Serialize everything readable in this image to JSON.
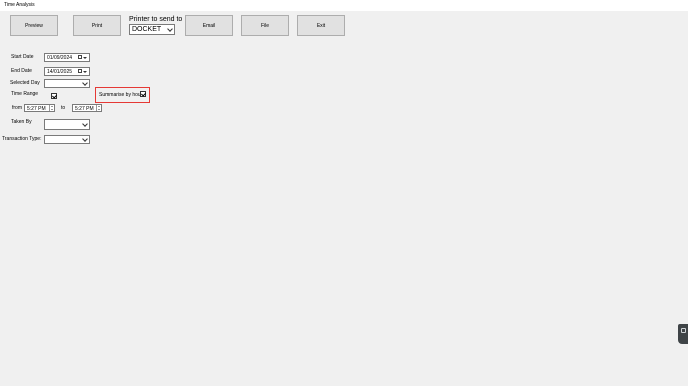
{
  "window": {
    "title": "Time Analysis"
  },
  "toolbar": {
    "preview": "Preview",
    "print": "Print",
    "email": "Email",
    "file": "File",
    "exit": "Exit"
  },
  "printer": {
    "label": "Printer to send to",
    "selected": "DOCKET"
  },
  "form": {
    "start_date_label": "Start Date",
    "start_date": "01/09/2024",
    "end_date_label": "End Date",
    "end_date": "14/01/2025",
    "selected_day_label": "Selected Day",
    "selected_day": "",
    "time_range_label": "Time Range",
    "time_range_checked": true,
    "summarise_label": "Summarise by hour",
    "summarise_checked": true,
    "from_label": "from",
    "from_time": "5:27 PM",
    "to_label": "to",
    "to_time": "5:27 PM",
    "taken_by_label": "Taken By",
    "taken_by": "",
    "transaction_type_label": "Transaction Type:",
    "transaction_type": ""
  }
}
